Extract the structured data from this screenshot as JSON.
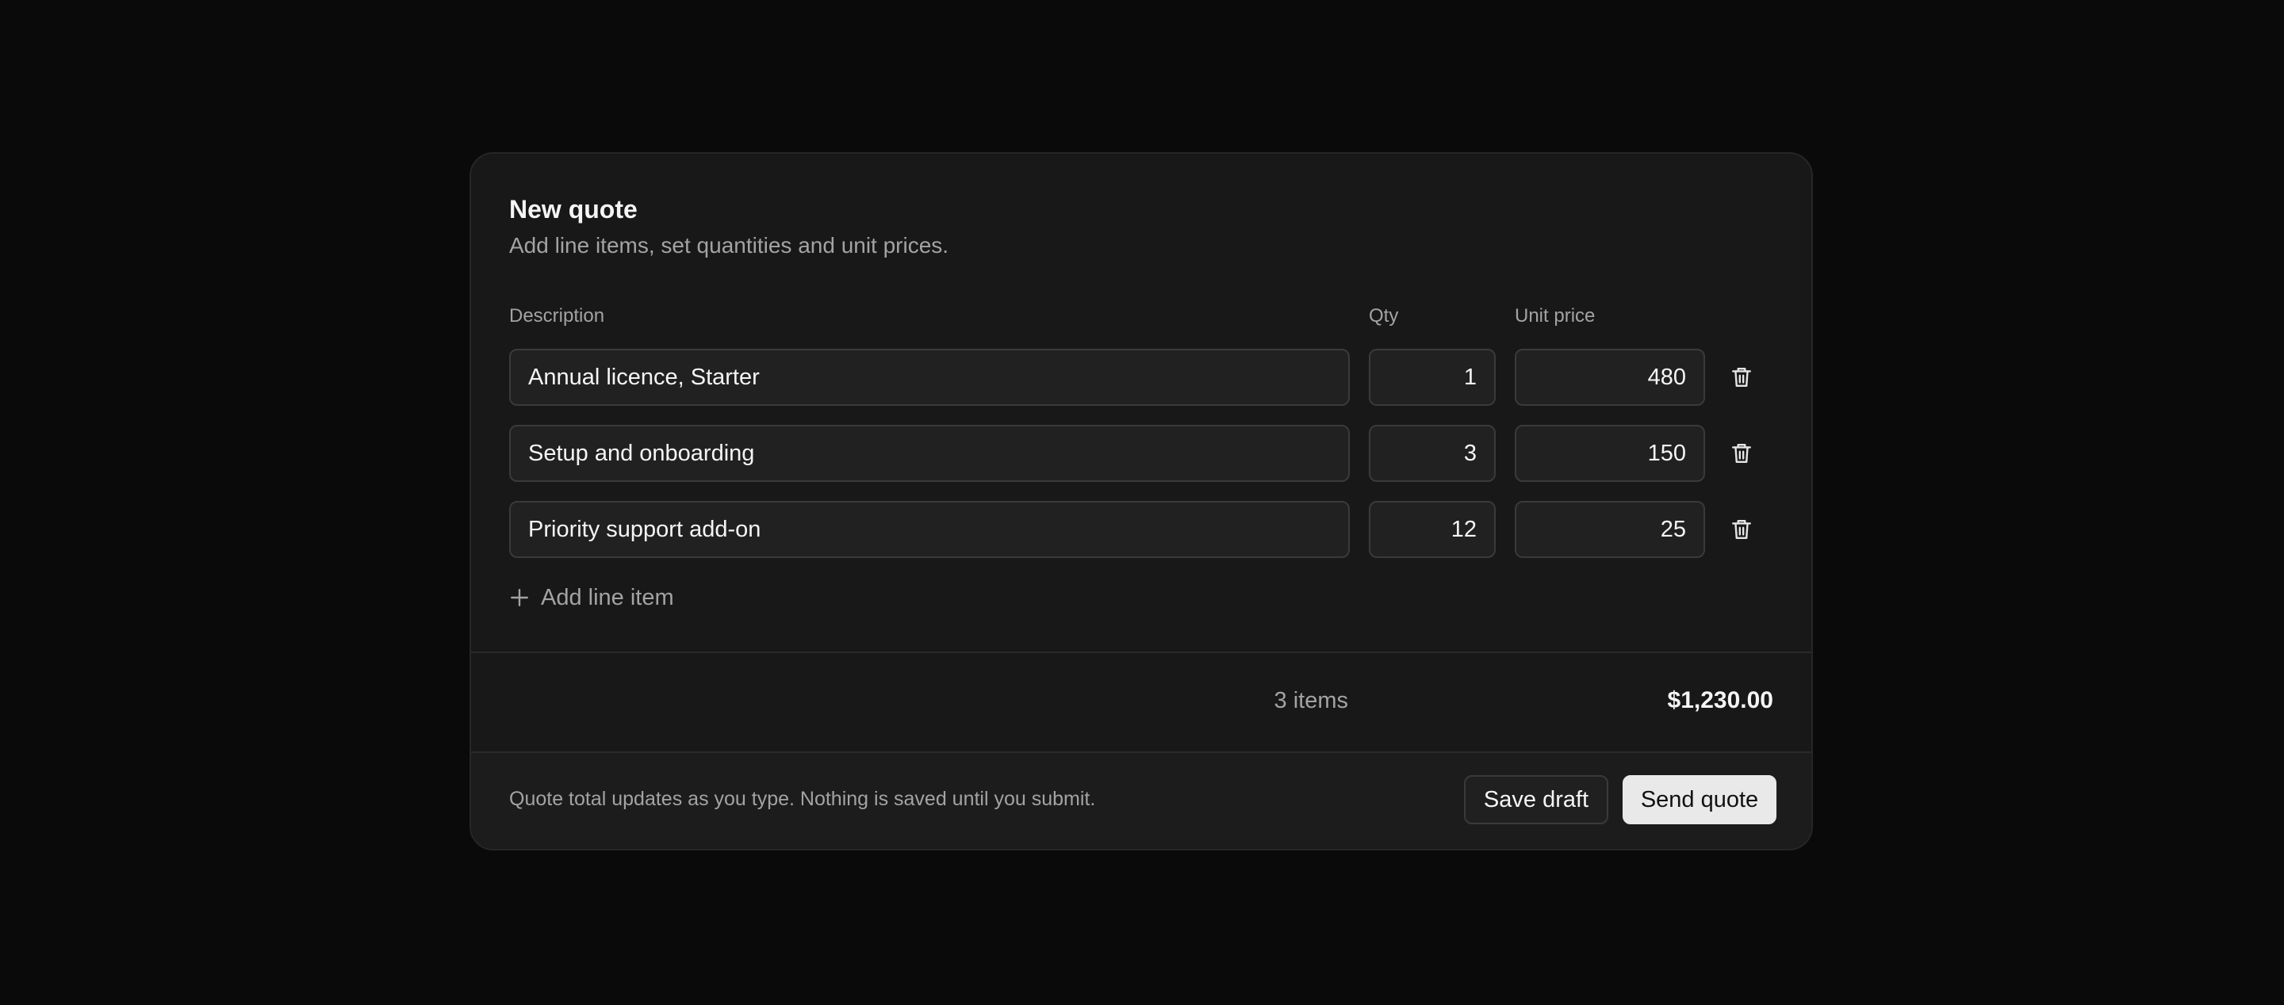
{
  "quote": {
    "title": "New quote",
    "subtitle": "Add line items, set quantities and unit prices."
  },
  "columns": {
    "description": "Description",
    "qty": "Qty",
    "unit_price": "Unit price"
  },
  "line_items": [
    {
      "description": "Annual licence, Starter",
      "qty": "1",
      "unit_price": "480"
    },
    {
      "description": "Setup and onboarding",
      "qty": "3",
      "unit_price": "150"
    },
    {
      "description": "Priority support add-on",
      "qty": "12",
      "unit_price": "25"
    }
  ],
  "add_line_item_label": "Add line item",
  "summary": {
    "count": "3 items",
    "total": "$1,230.00"
  },
  "footer": {
    "note": "Quote total updates as you type. Nothing is saved until you submit.",
    "save_draft_label": "Save draft",
    "send_quote_label": "Send quote"
  },
  "icons": {
    "delete": "trash-icon",
    "add": "plus-icon"
  },
  "colors": {
    "background": "#0a0a0a",
    "card": "#181818",
    "primary_button": "#e9e9e9"
  }
}
